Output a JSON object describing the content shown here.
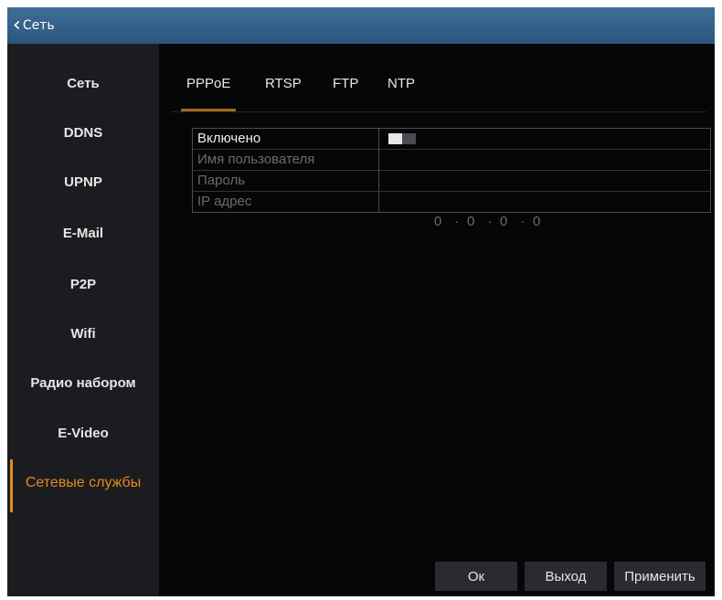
{
  "title_bar": {
    "back_label": "Сеть"
  },
  "sidebar": {
    "items": [
      {
        "label": "Сеть"
      },
      {
        "label": "DDNS"
      },
      {
        "label": "UPNP"
      },
      {
        "label": "E-Mail"
      },
      {
        "label": "P2P"
      },
      {
        "label": "Wifi"
      },
      {
        "label": "Радио набором"
      },
      {
        "label": "E-Video"
      },
      {
        "label": "Сетевые службы",
        "active": true
      }
    ]
  },
  "tabs": [
    {
      "label": "PPPoE",
      "active": true
    },
    {
      "label": "RTSP"
    },
    {
      "label": "FTP"
    },
    {
      "label": "NTP"
    }
  ],
  "pppoe": {
    "enabled_label": "Включено",
    "enabled": true,
    "username_label": "Имя пользователя",
    "username_value": "",
    "password_label": "Пароль",
    "password_value": "",
    "ip_label": "IP адрес",
    "ip_octets": [
      "0",
      "0",
      "0",
      "0"
    ]
  },
  "buttons": {
    "ok": "Ок",
    "exit": "Выход",
    "apply": "Применить"
  },
  "colors": {
    "accent": "#e28a1e",
    "titlebar": "#33618a"
  }
}
